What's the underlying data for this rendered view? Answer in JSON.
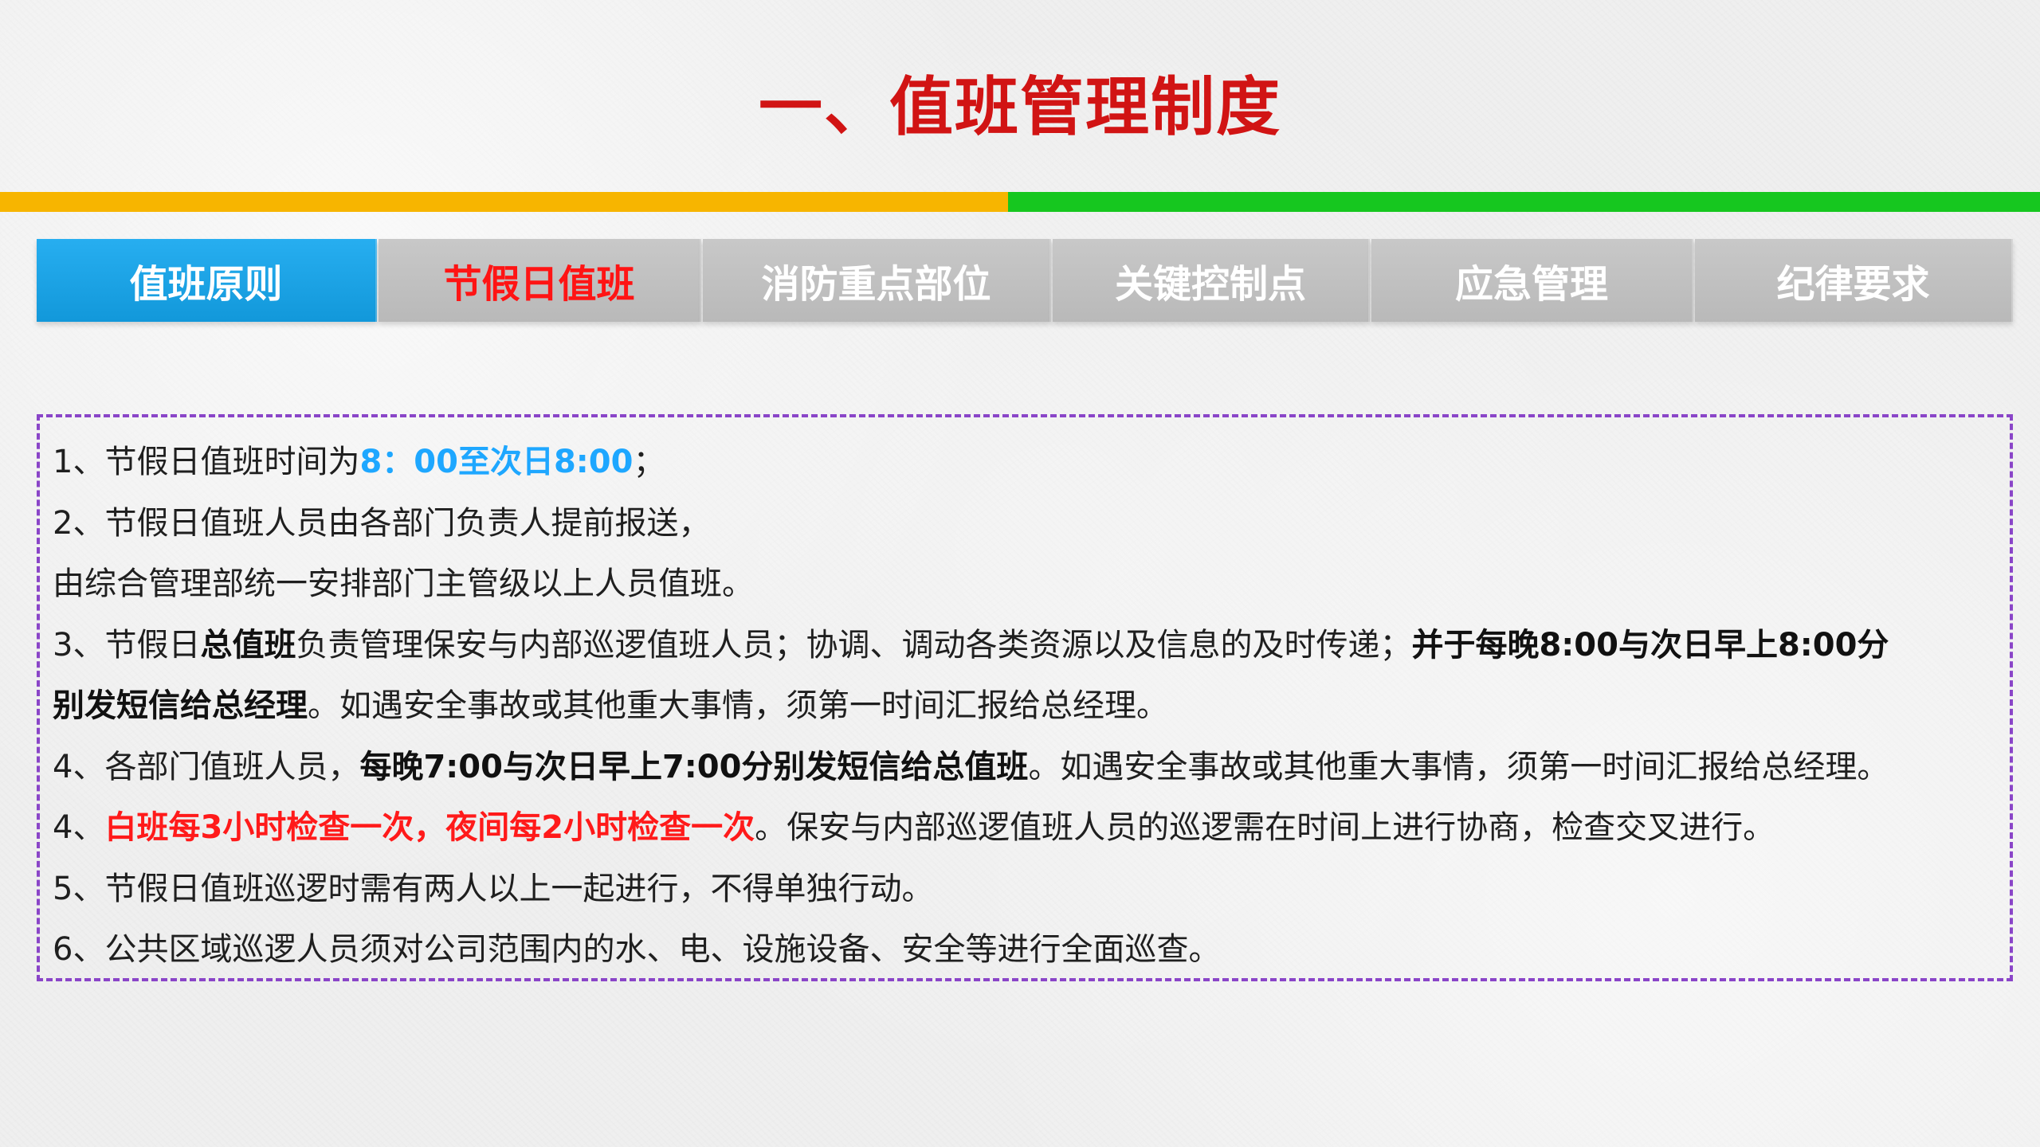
{
  "page_title": "一、值班管理制度",
  "tabs": [
    {
      "label": "值班原则"
    },
    {
      "label": "节假日值班"
    },
    {
      "label": "消防重点部位"
    },
    {
      "label": "关键控制点"
    },
    {
      "label": "应急管理"
    },
    {
      "label": "纪律要求"
    }
  ],
  "content": {
    "line1": {
      "a": "1、节假日值班时间为",
      "b": "8：00至次日8:00",
      "c": "；"
    },
    "line2": {
      "a": "2、节假日值班人员由各部门负责人提前报送，"
    },
    "line3": {
      "a": "由综合管理部统一安排部门主管级以上人员值班。"
    },
    "line4": {
      "a": "3、节假日",
      "b": "总值班",
      "c": "负责管理保安与内部巡逻值班人员；协调、调动各类资源以及信息的及时传递；",
      "d": "并于每晚8:00与次日早上8:00分"
    },
    "line5": {
      "a": "别发短信给总经理",
      "b": "。如遇安全事故或其他重大事情，须第一时间汇报给总经理。"
    },
    "line6": {
      "a": "4、各部门值班人员，",
      "b": "每晚7:00与次日早上7:00分别发短信给总值班",
      "c": "。如遇安全事故或其他重大事情，须第一时间汇报给总经理。"
    },
    "line7": {
      "a": "4、",
      "b": "白班每3小时检查一次，夜间每2小时检查一次",
      "c": "。保安与内部巡逻值班人员的巡逻需在时间上进行协商，检查交叉进行。"
    },
    "line8": {
      "a": "5、节假日值班巡逻时需有两人以上一起进行，不得单独行动。"
    },
    "line9": {
      "a": "6、公共区域巡逻人员须对公司范围内的水、电、设施设备、安全等进行全面巡查。"
    }
  },
  "colors": {
    "title_red": "#d11414",
    "bar_yellow": "#f7b500",
    "bar_green": "#16c71f",
    "tab_active_blue": "#1ea2e6",
    "tab_gray": "#c0c0c0",
    "tab_current_text": "#ff1414",
    "highlight_blue": "#1ea7ff",
    "highlight_red": "#ff1a1a",
    "border_purple": "#8a45c8"
  }
}
